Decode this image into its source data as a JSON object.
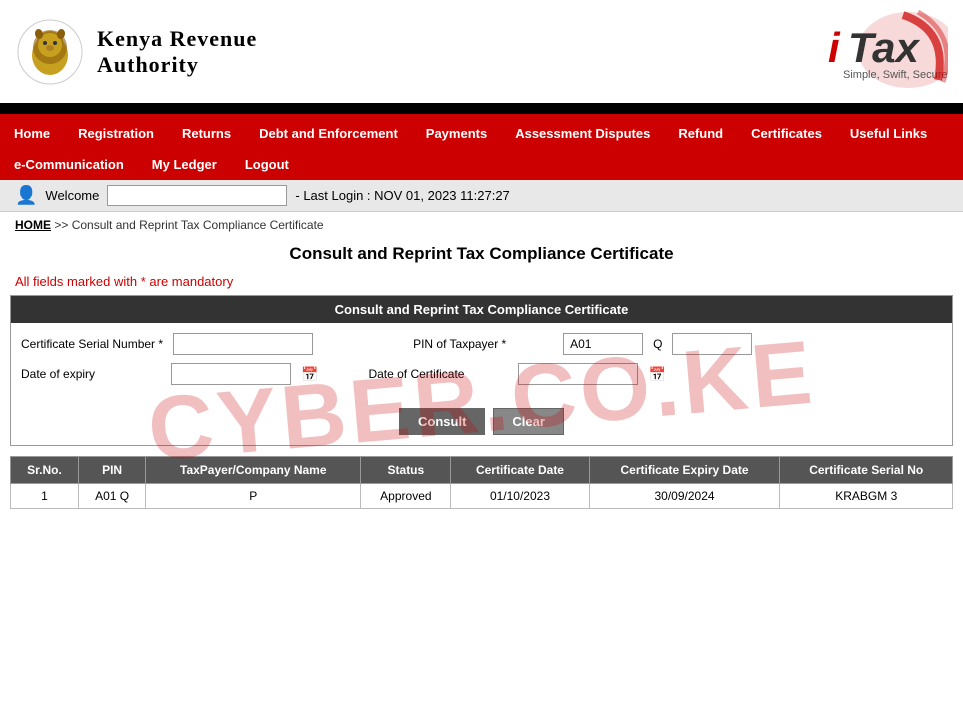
{
  "header": {
    "org_name_line1": "Kenya Revenue",
    "org_name_line2": "Authority",
    "itax_brand": "iTax",
    "itax_tagline": "Simple, Swift, Secure"
  },
  "nav": {
    "items": [
      {
        "label": "Home",
        "href": "#"
      },
      {
        "label": "Registration",
        "href": "#"
      },
      {
        "label": "Returns",
        "href": "#"
      },
      {
        "label": "Debt and Enforcement",
        "href": "#"
      },
      {
        "label": "Payments",
        "href": "#"
      },
      {
        "label": "Assessment Disputes",
        "href": "#"
      },
      {
        "label": "Refund",
        "href": "#"
      },
      {
        "label": "Certificates",
        "href": "#"
      },
      {
        "label": "Useful Links",
        "href": "#"
      },
      {
        "label": "e-Communication",
        "href": "#"
      },
      {
        "label": "My Ledger",
        "href": "#"
      },
      {
        "label": "Logout",
        "href": "#"
      }
    ]
  },
  "welcome": {
    "text": "Welcome",
    "username": "",
    "last_login_label": "- Last Login : NOV 01, 2023 11:27:27"
  },
  "breadcrumb": {
    "home_label": "HOME",
    "separator": ">>",
    "current": "Consult and Reprint Tax Compliance Certificate"
  },
  "page": {
    "title": "Consult and Reprint Tax Compliance Certificate",
    "mandatory_note": "All fields marked with * are mandatory"
  },
  "form": {
    "section_title": "Consult and Reprint Tax Compliance Certificate",
    "fields": {
      "cert_serial_label": "Certificate Serial Number *",
      "cert_serial_value": "",
      "pin_label": "PIN of Taxpayer *",
      "pin_value": "A01",
      "pin_suffix": "Q",
      "date_expiry_label": "Date of expiry",
      "date_expiry_value": "",
      "date_cert_label": "Date of Certificate",
      "date_cert_value": ""
    },
    "buttons": {
      "consult": "Consult",
      "clear": "Clear"
    }
  },
  "table": {
    "columns": [
      "Sr.No.",
      "PIN",
      "TaxPayer/Company Name",
      "Status",
      "Certificate Date",
      "Certificate Expiry Date",
      "Certificate Serial No"
    ],
    "rows": [
      {
        "sr": "1",
        "pin": "A01        Q",
        "name": "P",
        "status": "Approved",
        "cert_date": "01/10/2023",
        "expiry_date": "30/09/2024",
        "serial": "KRABGM        3"
      }
    ]
  },
  "watermark": {
    "text": "CYBER.CO.KE"
  }
}
